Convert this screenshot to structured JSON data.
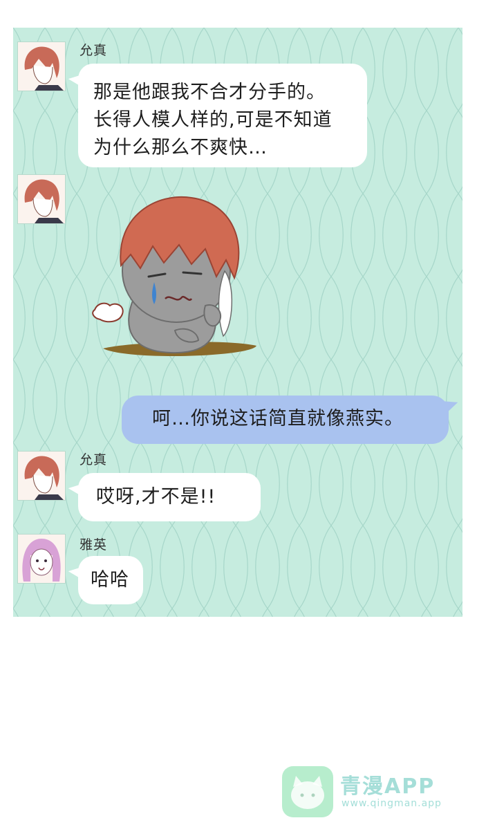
{
  "colors": {
    "panel_background": "#c6ecdf",
    "panel_pattern": "#9fd0c4",
    "incoming_bubble": "#ffffff",
    "outgoing_bubble": "#a9c2ef",
    "watermark": "#8fd6cf"
  },
  "messages": [
    {
      "sender": "允真",
      "lines": [
        "那是他跟我不合才分手的。",
        "长得人模人样的,可是不知道",
        "为什么那么不爽快…"
      ]
    },
    {
      "sender_avatar": "允真",
      "sticker": "grumpy-boy-sticker"
    },
    {
      "outgoing": true,
      "text": "呵…你说这话简直就像燕实。"
    },
    {
      "sender": "允真",
      "text": "哎呀,才不是!!"
    },
    {
      "sender": "雅英",
      "text": "哈哈"
    }
  ],
  "watermark": {
    "title": "青漫APP",
    "url": "www.qingman.app"
  }
}
